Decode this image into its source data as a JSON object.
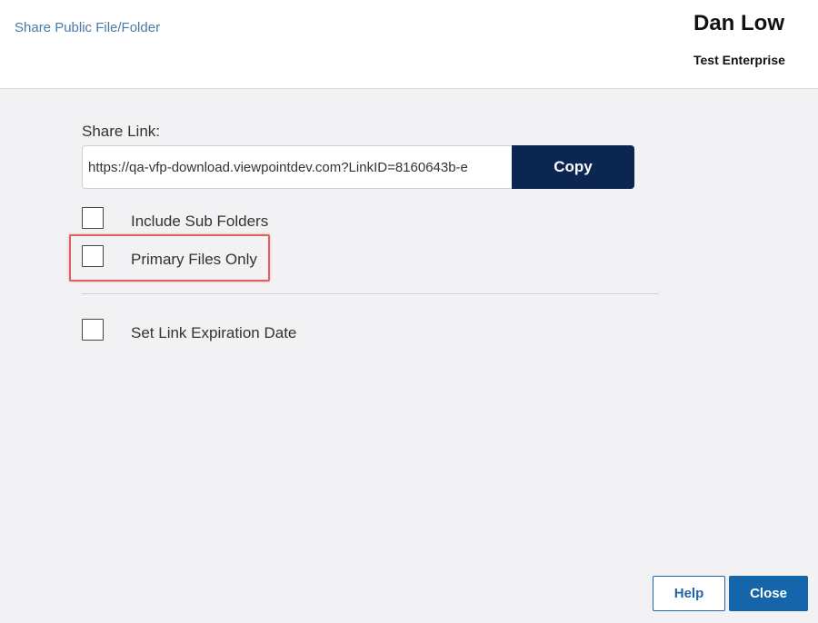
{
  "header": {
    "title": "Share Public File/Folder",
    "user_name": "Dan Low",
    "enterprise": "Test Enterprise"
  },
  "share": {
    "label": "Share Link:",
    "link_value": "https://qa-vfp-download.viewpointdev.com?LinkID=8160643b-e",
    "copy_label": "Copy"
  },
  "options": {
    "include_sub_folders": {
      "label": "Include Sub Folders",
      "checked": false
    },
    "primary_files_only": {
      "label": "Primary Files Only",
      "checked": false
    },
    "set_link_expiration": {
      "label": "Set Link Expiration Date",
      "checked": false
    }
  },
  "footer": {
    "help_label": "Help",
    "close_label": "Close"
  },
  "colors": {
    "accent_dark": "#0b2651",
    "primary_blue": "#1565aa",
    "link_blue": "#4a7aa8",
    "highlight_red": "#e06060"
  }
}
